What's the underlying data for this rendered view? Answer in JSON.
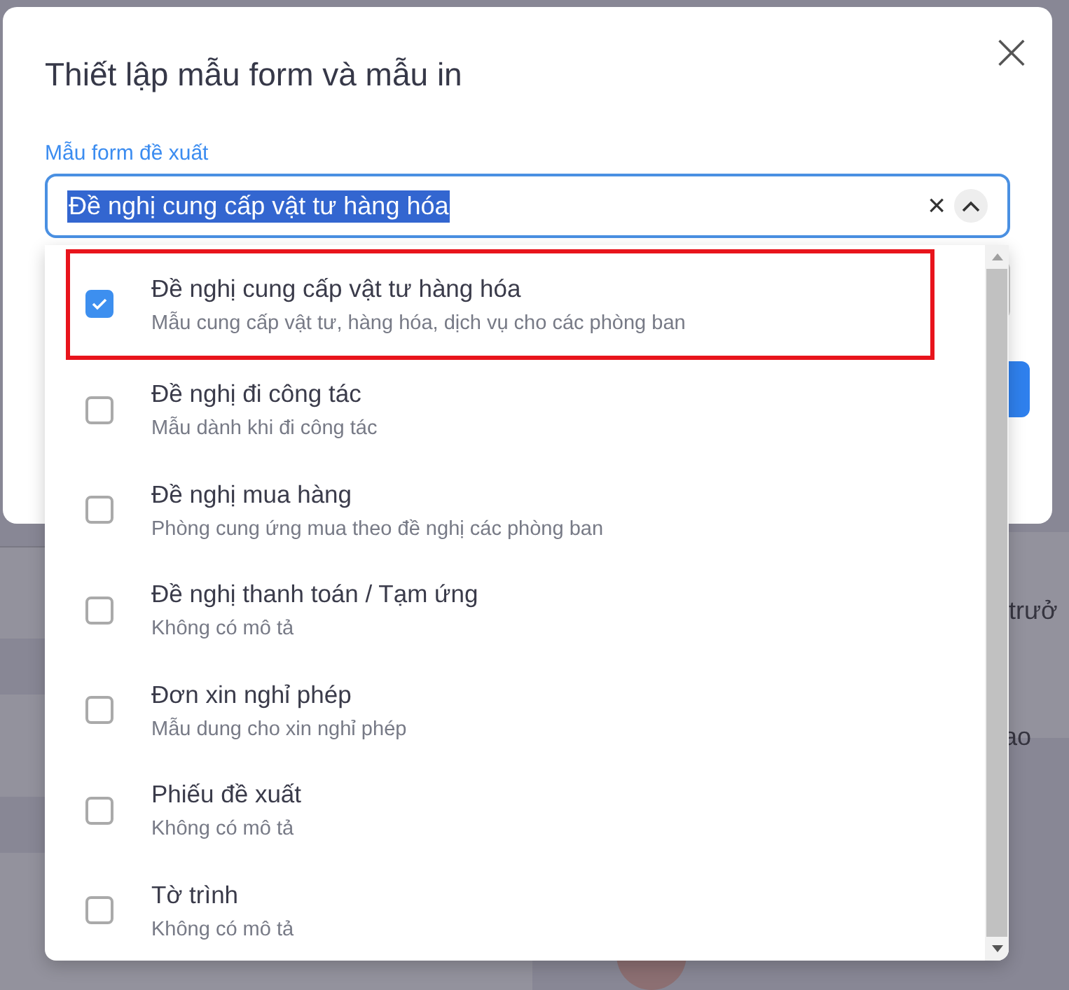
{
  "background": {
    "texts": [
      {
        "text": "trưở"
      },
      {
        "text": "ao"
      }
    ]
  },
  "dialog": {
    "title": "Thiết lập mẫu form và mẫu in",
    "close": "×",
    "field": {
      "label": "Mẫu form đề xuất",
      "value": "Đề nghị cung cấp vật tư hàng hóa",
      "clear": "×"
    },
    "options": [
      {
        "title": "Đề nghị cung cấp vật tư hàng hóa",
        "description": "Mẫu cung cấp vật tư, hàng hóa, dịch vụ cho các phòng ban",
        "checked": true,
        "highlighted": true
      },
      {
        "title": "Đề nghị đi công tác",
        "description": "Mẫu dành khi đi công tác",
        "checked": false,
        "highlighted": false
      },
      {
        "title": "Đề nghị mua hàng",
        "description": "Phòng cung ứng mua theo đề nghị các phòng ban",
        "checked": false,
        "highlighted": false
      },
      {
        "title": "Đề nghị thanh toán / Tạm ứng",
        "description": "Không có mô tả",
        "checked": false,
        "highlighted": false
      },
      {
        "title": "Đơn xin nghỉ phép",
        "description": "Mẫu dung cho xin nghỉ phép",
        "checked": false,
        "highlighted": false
      },
      {
        "title": "Phiếu đề xuất",
        "description": "Không có mô tả",
        "checked": false,
        "highlighted": false
      },
      {
        "title": "Tờ trình",
        "description": "Không có mô tả",
        "checked": false,
        "highlighted": false
      }
    ]
  }
}
